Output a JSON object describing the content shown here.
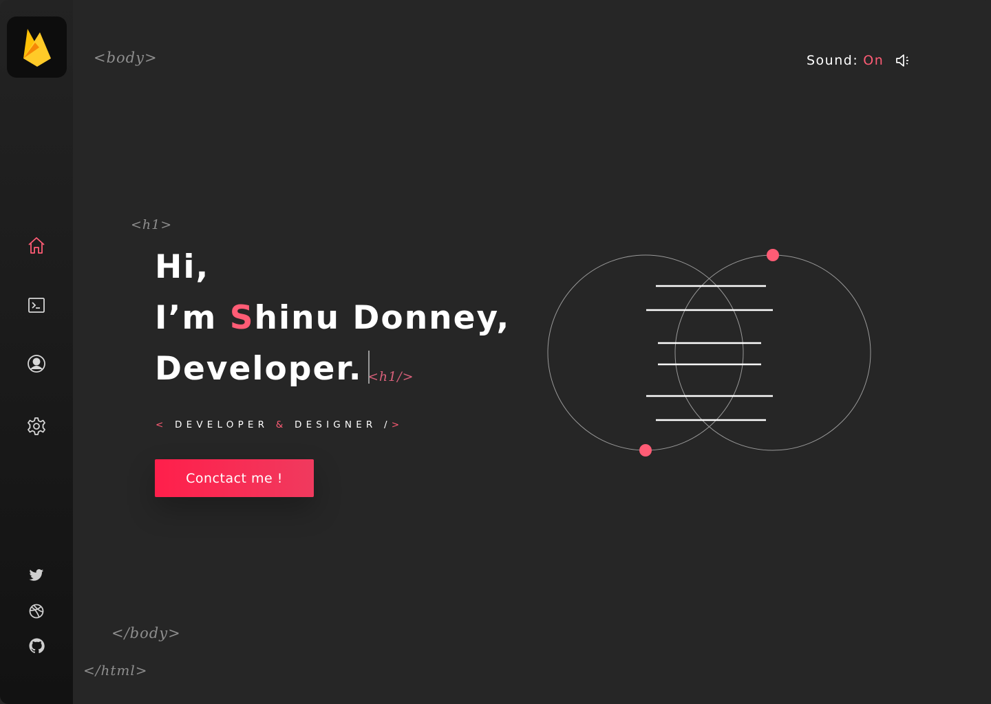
{
  "brand": {
    "logo_icon": "firebase-flame-icon"
  },
  "sidebar": {
    "nav": [
      {
        "name": "home",
        "icon": "home-icon",
        "active": true
      },
      {
        "name": "terminal",
        "icon": "terminal-icon",
        "active": false
      },
      {
        "name": "profile",
        "icon": "user-circle-icon",
        "active": false
      },
      {
        "name": "settings",
        "icon": "gear-icon",
        "active": false
      }
    ],
    "social": [
      {
        "name": "twitter",
        "icon": "twitter-icon"
      },
      {
        "name": "dribbble",
        "icon": "dribbble-icon"
      },
      {
        "name": "github",
        "icon": "github-icon"
      }
    ]
  },
  "code_tags": {
    "body_open": "<body>",
    "h1_open": "<h1>",
    "h1_close": "<h1/>",
    "body_close": "</body>",
    "html_close": "</html>"
  },
  "sound": {
    "label": "Sound:",
    "state": "On",
    "icon": "speaker-icon"
  },
  "hero": {
    "line1": "Hi,",
    "line2_prefix": "I’m ",
    "line2_accent": "S",
    "line2_rest": "hinu Donney,",
    "line3": "Developer."
  },
  "role": {
    "open": "<",
    "part1": "DEVELOPER",
    "amp": "&",
    "part2": "DESIGNER",
    "slash": "/",
    "close": ">"
  },
  "cta": {
    "label": "Conctact me !"
  },
  "colors": {
    "accent": "#ff5c75",
    "background": "#262626",
    "button": "#ff1f4b"
  }
}
